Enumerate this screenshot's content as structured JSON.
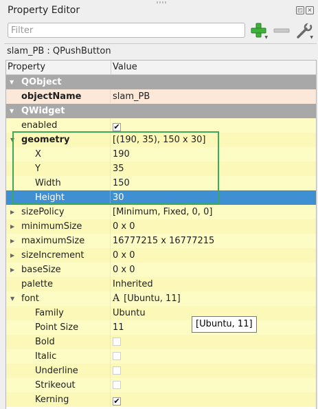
{
  "panel": {
    "title": "Property Editor",
    "float_icon": "float-icon",
    "close_icon": "close-icon"
  },
  "toolbar": {
    "filter_placeholder": "Filter",
    "filter_value": "",
    "add_icon": "add-plus-icon",
    "remove_icon": "remove-minus-icon",
    "config_icon": "wrench-config-icon"
  },
  "object_label": "slam_PB : QPushButton",
  "columns": {
    "property": "Property",
    "value": "Value"
  },
  "rows": [
    {
      "name": "QObject",
      "value": "",
      "kind": "section",
      "expanded": true
    },
    {
      "name": "objectName",
      "value": "slam_PB",
      "kind": "light-orange",
      "bold": true
    },
    {
      "name": "QWidget",
      "value": "",
      "kind": "section",
      "expanded": true
    },
    {
      "name": "enabled",
      "value": "",
      "kind": "yellow",
      "checkbox": "checked"
    },
    {
      "name": "geometry",
      "value": "[(190, 35), 150 x 30]",
      "kind": "yellow-2",
      "bold": true,
      "expander": "expanded"
    },
    {
      "name": "X",
      "value": "190",
      "kind": "yellow",
      "indent": 2
    },
    {
      "name": "Y",
      "value": "35",
      "kind": "yellow-2",
      "indent": 2
    },
    {
      "name": "Width",
      "value": "150",
      "kind": "yellow",
      "indent": 2
    },
    {
      "name": "Height",
      "value": "30",
      "kind": "selected",
      "indent": 2
    },
    {
      "name": "sizePolicy",
      "value": "[Minimum, Fixed, 0, 0]",
      "kind": "yellow",
      "expander": "collapsed"
    },
    {
      "name": "minimumSize",
      "value": "0 x 0",
      "kind": "yellow-2",
      "expander": "collapsed"
    },
    {
      "name": "maximumSize",
      "value": "16777215 x 16777215",
      "kind": "yellow",
      "expander": "collapsed"
    },
    {
      "name": "sizeIncrement",
      "value": "0 x 0",
      "kind": "yellow-2",
      "expander": "collapsed"
    },
    {
      "name": "baseSize",
      "value": "0 x 0",
      "kind": "yellow",
      "expander": "collapsed"
    },
    {
      "name": "palette",
      "value": "Inherited",
      "kind": "yellow-2"
    },
    {
      "name": "font",
      "value": "[Ubuntu, 11]",
      "kind": "yellow",
      "expander": "expanded",
      "font_icon": "A"
    },
    {
      "name": "Family",
      "value": "Ubuntu",
      "kind": "yellow-2",
      "indent": 2
    },
    {
      "name": "Point Size",
      "value": "11",
      "kind": "yellow",
      "indent": 2
    },
    {
      "name": "Bold",
      "value": "",
      "kind": "yellow-2",
      "indent": 2,
      "checkbox": "disabled"
    },
    {
      "name": "Italic",
      "value": "",
      "kind": "yellow",
      "indent": 2,
      "checkbox": "disabled"
    },
    {
      "name": "Underline",
      "value": "",
      "kind": "yellow-2",
      "indent": 2,
      "checkbox": "disabled"
    },
    {
      "name": "Strikeout",
      "value": "",
      "kind": "yellow",
      "indent": 2,
      "checkbox": "disabled"
    },
    {
      "name": "Kerning",
      "value": "",
      "kind": "yellow-2",
      "indent": 2,
      "checkbox": "checked"
    }
  ],
  "tooltip": "[Ubuntu, 11]",
  "colors": {
    "section_bg": "#a8a8a8",
    "row_yellow": "#fdfcc4",
    "row_orange": "#fce8d9",
    "selection": "#3f8fd3",
    "highlight_border": "#3ba85c"
  }
}
